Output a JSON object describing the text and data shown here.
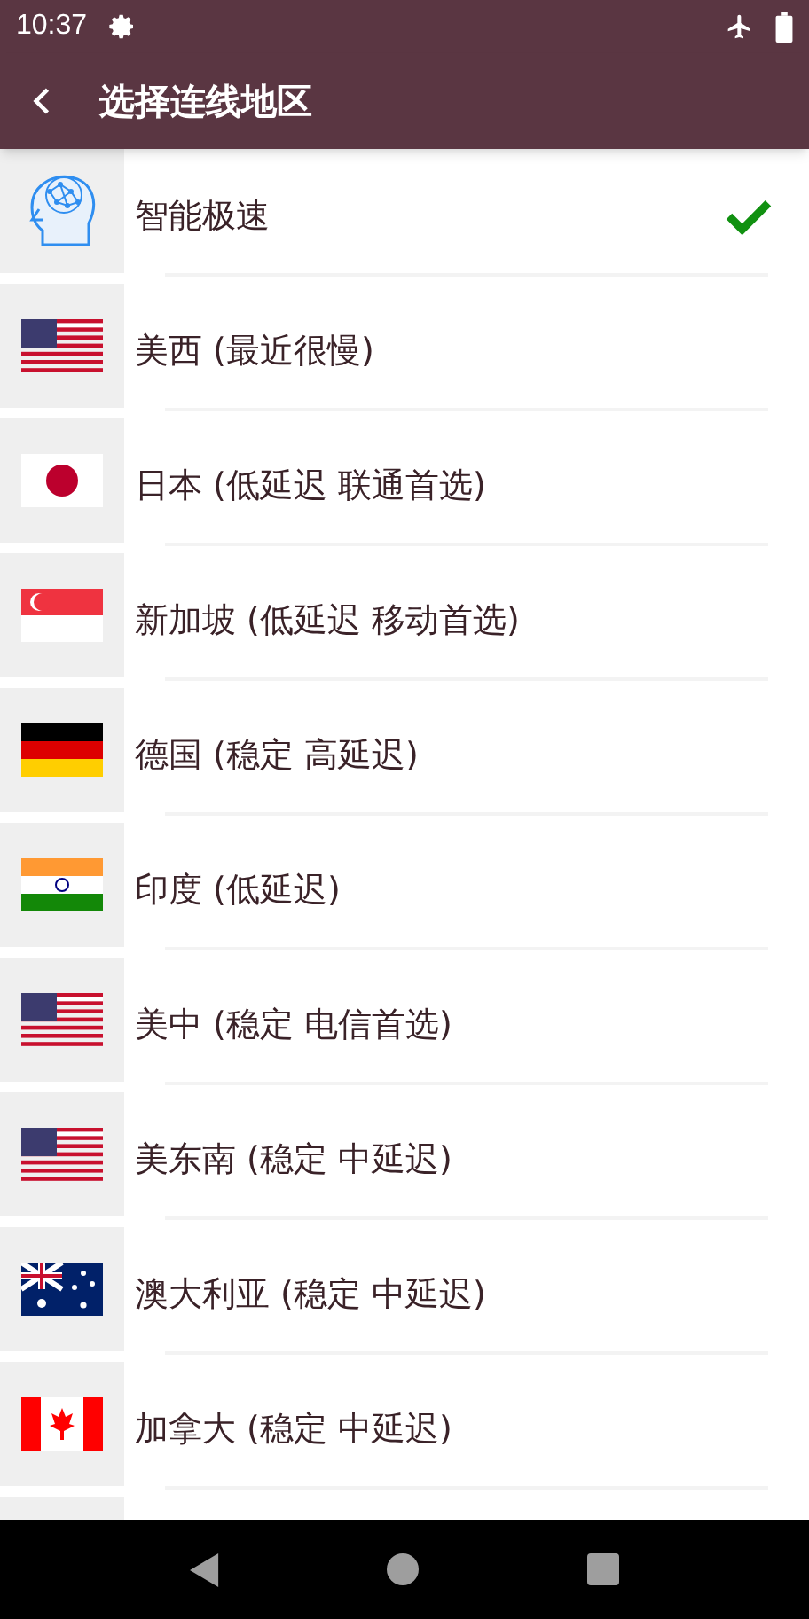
{
  "status_bar": {
    "time": "10:37"
  },
  "app_bar": {
    "title": "选择连线地区"
  },
  "regions": [
    {
      "kind": "brain",
      "label": "智能极速",
      "selected": true
    },
    {
      "kind": "us",
      "label": "美西 (最近很慢)",
      "selected": false
    },
    {
      "kind": "jp",
      "label": "日本 (低延迟 联通首选)",
      "selected": false
    },
    {
      "kind": "sg",
      "label": "新加坡 (低延迟 移动首选)",
      "selected": false
    },
    {
      "kind": "de",
      "label": "德国 (稳定 高延迟)",
      "selected": false
    },
    {
      "kind": "in",
      "label": "印度 (低延迟)",
      "selected": false
    },
    {
      "kind": "us",
      "label": "美中 (稳定 电信首选)",
      "selected": false
    },
    {
      "kind": "us",
      "label": "美东南 (稳定 中延迟)",
      "selected": false
    },
    {
      "kind": "au",
      "label": "澳大利亚 (稳定 中延迟)",
      "selected": false
    },
    {
      "kind": "ca",
      "label": "加拿大 (稳定 中延迟)",
      "selected": false
    }
  ]
}
